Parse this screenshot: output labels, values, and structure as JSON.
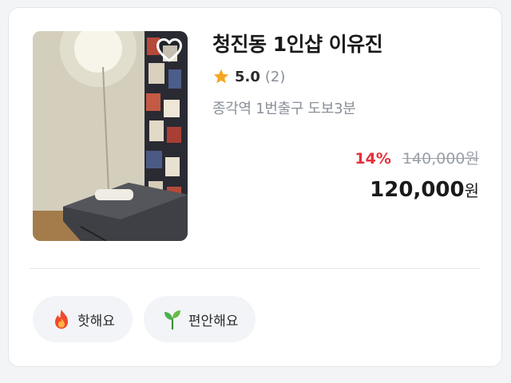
{
  "listing": {
    "title": "청진동 1인샵 이유진",
    "rating": "5.0",
    "review_count": "(2)",
    "location": "종각역 1번출구 도보3분",
    "discount": "14%",
    "original_price": "140,000원",
    "final_price": "120,000",
    "currency": "원",
    "favorite_icon": "heart-outline-icon"
  },
  "tags": [
    {
      "label": "핫해요",
      "icon": "fire-icon"
    },
    {
      "label": "편안해요",
      "icon": "sprout-icon"
    }
  ],
  "colors": {
    "discount": "#e6303a",
    "star": "#f5a623",
    "muted_text": "#8a8f98",
    "tag_bg": "#f2f4f7"
  }
}
